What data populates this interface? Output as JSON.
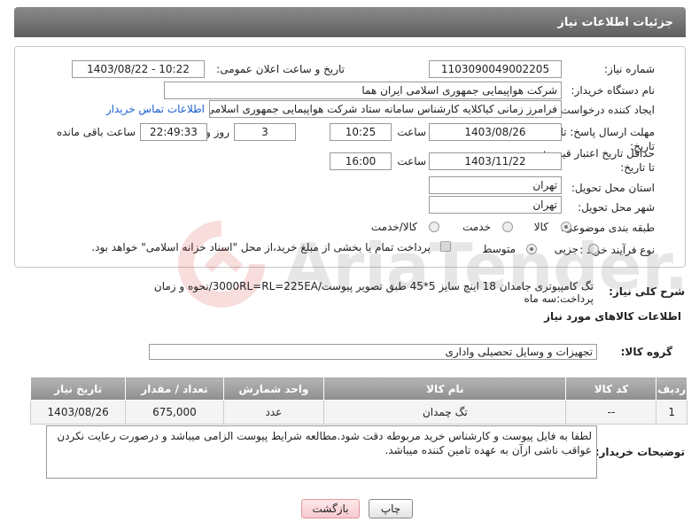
{
  "header": {
    "title": "جزئیات اطلاعات نیاز"
  },
  "form": {
    "need_number": {
      "label": "شماره نیاز:",
      "value": "1103090049002205"
    },
    "announce": {
      "label": "تاریخ و ساعت اعلان عمومی:",
      "value": "1403/08/22 - 10:22"
    },
    "buyer": {
      "label": "نام دستگاه خریدار:",
      "value": "شرکت هواپیمایی جمهوری اسلامی ایران هما"
    },
    "creator": {
      "label": "ایجاد کننده درخواست:",
      "value": "فرامرز زمانی کیاکلایه کارشناس سامانه ستاد شرکت هواپیمایی جمهوری اسلامی",
      "contact_link": "اطلاعات تماس خریدار"
    },
    "deadline": {
      "label": "مهلت ارسال پاسخ: تا تاریخ:",
      "date": "1403/08/26",
      "time_label": "ساعت",
      "time": "10:25",
      "days": "3",
      "days_label": "روز و",
      "remaining": "22:49:33",
      "remaining_label": "ساعت باقی مانده"
    },
    "validity": {
      "label": "حداقل تاریخ اعتبار قیمت: تا تاریخ:",
      "date": "1403/11/22",
      "time_label": "ساعت",
      "time": "16:00"
    },
    "province": {
      "label": "استان محل تحویل:",
      "value": "تهران"
    },
    "city": {
      "label": "شهر محل تحویل:",
      "value": "تهران"
    },
    "category": {
      "label": "طبقه بندی موضوعی:",
      "options": [
        "کالا",
        "خدمت",
        "کالا/خدمت"
      ],
      "selected": "کالا"
    },
    "process": {
      "label": "نوع فرآیند خرید :",
      "options": [
        "جزیی",
        "متوسط"
      ],
      "selected": "متوسط",
      "payment_note": "پرداخت تمام یا بخشی از مبلغ خرید،از محل \"اسناد خزانه اسلامی\" خواهد بود."
    }
  },
  "description": {
    "label": "شرح کلی نیاز:",
    "value": "تگ کامپیوتری جامدان 18 اینچ سایز  5*45 طبق تصویر پیوست/3000RL=RL=225EA/نحوه و زمان پرداخت:سه ماه"
  },
  "goods_info": {
    "heading": "اطلاعات کالاهای مورد نیاز",
    "group_label": "گروه کالا:",
    "group_value": "تجهیزات و وسایل تحصیلی واداری"
  },
  "table": {
    "headers": [
      "ردیف",
      "کد کالا",
      "نام کالا",
      "واحد شمارش",
      "تعداد / مقدار",
      "تاریخ نیاز"
    ],
    "rows": [
      [
        "1",
        "--",
        "تگ چمدان",
        "عدد",
        "675,000",
        "1403/08/26"
      ]
    ]
  },
  "buyer_notes": {
    "label": "توضیحات خریدار:",
    "value": "لطفا به فایل پیوست و کارشناس خرید مربوطه دقت شود.مطالعه شرایط پیوست الزامی میباشد و درصورت رعایت نکردن عواقب ناشی ازآن به عهده تامین کننده میباشد."
  },
  "buttons": {
    "print": "چاپ",
    "back": "بازگشت"
  },
  "watermark": "AriaTender.neT"
}
